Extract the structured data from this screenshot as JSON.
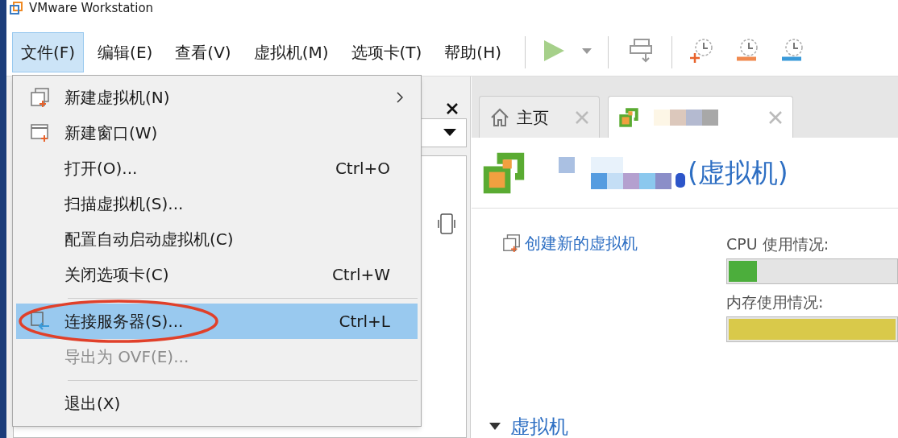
{
  "window": {
    "title": "VMware Workstation"
  },
  "menu_bar": [
    {
      "label": "文件(F)",
      "selected": true
    },
    {
      "label": "编辑(E)",
      "selected": false
    },
    {
      "label": "查看(V)",
      "selected": false
    },
    {
      "label": "虚拟机(M)",
      "selected": false
    },
    {
      "label": "选项卡(T)",
      "selected": false
    },
    {
      "label": "帮助(H)",
      "selected": false
    }
  ],
  "file_menu": [
    {
      "kind": "item",
      "label": "新建虚拟机(N)",
      "submenu": true,
      "highlighted": false,
      "disabled": false,
      "circled": false
    },
    {
      "kind": "item",
      "label": "新建窗口(W)",
      "submenu": false,
      "highlighted": false,
      "disabled": false,
      "circled": false
    },
    {
      "kind": "item",
      "label": "打开(O)...",
      "shortcut": "Ctrl+O",
      "submenu": false,
      "highlighted": false,
      "disabled": false,
      "circled": false
    },
    {
      "kind": "item",
      "label": "扫描虚拟机(S)...",
      "submenu": false,
      "highlighted": false,
      "disabled": false,
      "circled": false
    },
    {
      "kind": "item",
      "label": "配置自动启动虚拟机(C)",
      "submenu": false,
      "highlighted": false,
      "disabled": false,
      "circled": false
    },
    {
      "kind": "item",
      "label": "关闭选项卡(C)",
      "shortcut": "Ctrl+W",
      "submenu": false,
      "highlighted": false,
      "disabled": false,
      "circled": false
    },
    {
      "kind": "separator"
    },
    {
      "kind": "item",
      "label": "连接服务器(S)...",
      "shortcut": "Ctrl+L",
      "submenu": false,
      "highlighted": true,
      "disabled": false,
      "circled": true
    },
    {
      "kind": "item",
      "label": "导出为 OVF(E)...",
      "submenu": false,
      "highlighted": false,
      "disabled": true,
      "circled": false
    },
    {
      "kind": "separator"
    },
    {
      "kind": "item",
      "label": "退出(X)",
      "submenu": false,
      "highlighted": false,
      "disabled": false,
      "circled": false
    }
  ],
  "tabs": [
    {
      "kind": "home",
      "label": "主页",
      "selected": false
    },
    {
      "kind": "vm",
      "selected": true
    }
  ],
  "vm_page": {
    "title_suffix": "(虚拟机)",
    "create_link": "创建新的虚拟机",
    "meters": [
      {
        "label": "CPU 使用情况:",
        "level": 0.17,
        "color": "#4cae3c"
      },
      {
        "label": "内存使用情况:",
        "level": 1,
        "color": "#d9c94a"
      }
    ],
    "section": {
      "label": "虚拟机",
      "expanded": true
    }
  }
}
